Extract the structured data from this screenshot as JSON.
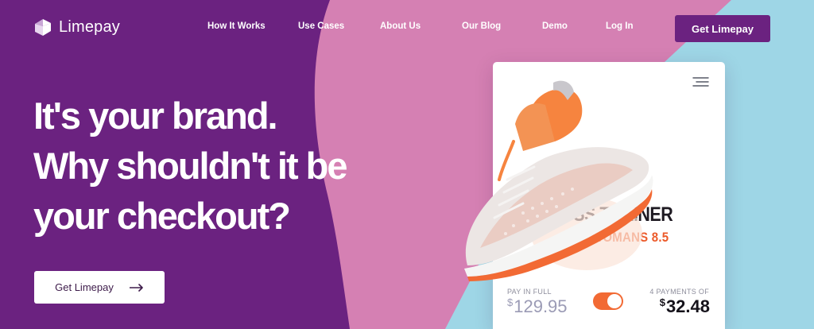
{
  "brand": {
    "name": "Limepay"
  },
  "nav": {
    "items": [
      {
        "id": "how-it-works",
        "label": "How It Works"
      },
      {
        "id": "use-cases",
        "label": "Use Cases"
      },
      {
        "id": "about-us",
        "label": "About Us"
      },
      {
        "id": "our-blog",
        "label": "Our Blog"
      },
      {
        "id": "demo",
        "label": "Demo"
      },
      {
        "id": "log-in",
        "label": "Log In"
      }
    ],
    "cta_label": "Get Limepay"
  },
  "hero": {
    "headline": [
      "It's your brand.",
      "Why shouldn't it be",
      "your checkout?"
    ],
    "cta_label": "Get Limepay"
  },
  "product_card": {
    "title": "OSS TRAINER",
    "subtitle": "WOMANS  8.5",
    "pay_full": {
      "label": "PAY IN FULL",
      "currency": "$",
      "amount": "129.95"
    },
    "installments": {
      "label": "4 PAYMENTS OF",
      "currency": "$",
      "amount": "32.48"
    },
    "toggle_on": true
  },
  "colors": {
    "purple": "#6b2280",
    "pink": "#d580b3",
    "light_blue": "#9ed6e6",
    "accent_orange": "#ec5a2a",
    "white": "#ffffff"
  }
}
